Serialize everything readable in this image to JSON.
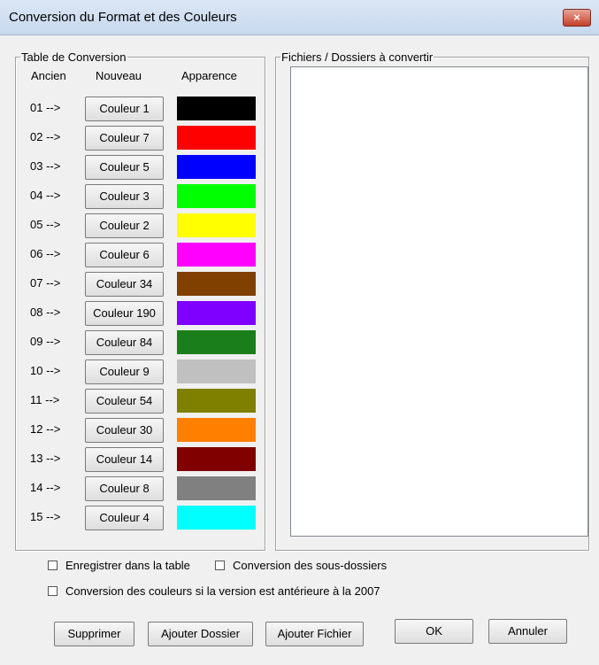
{
  "window": {
    "title": "Conversion du Format et des Couleurs",
    "close_label": "×"
  },
  "table_group": {
    "legend": "Table de Conversion",
    "header_old": "Ancien",
    "header_new": "Nouveau",
    "header_look": "Apparence",
    "rows": [
      {
        "old": "01 -->",
        "new": "Couleur 1",
        "color": "#000000"
      },
      {
        "old": "02 -->",
        "new": "Couleur 7",
        "color": "#ff0000"
      },
      {
        "old": "03 -->",
        "new": "Couleur 5",
        "color": "#0000ff"
      },
      {
        "old": "04 -->",
        "new": "Couleur 3",
        "color": "#00ff00"
      },
      {
        "old": "05 -->",
        "new": "Couleur 2",
        "color": "#ffff00"
      },
      {
        "old": "06 -->",
        "new": "Couleur 6",
        "color": "#ff00ff"
      },
      {
        "old": "07 -->",
        "new": "Couleur 34",
        "color": "#804000"
      },
      {
        "old": "08 -->",
        "new": "Couleur 190",
        "color": "#8000ff"
      },
      {
        "old": "09 -->",
        "new": "Couleur 84",
        "color": "#1a7f1a"
      },
      {
        "old": "10 -->",
        "new": "Couleur 9",
        "color": "#c0c0c0"
      },
      {
        "old": "11 -->",
        "new": "Couleur 54",
        "color": "#808000"
      },
      {
        "old": "12 -->",
        "new": "Couleur 30",
        "color": "#ff8000"
      },
      {
        "old": "13 -->",
        "new": "Couleur 14",
        "color": "#800000"
      },
      {
        "old": "14 -->",
        "new": "Couleur 8",
        "color": "#808080"
      },
      {
        "old": "15 -->",
        "new": "Couleur 4",
        "color": "#00ffff"
      }
    ]
  },
  "files_group": {
    "legend": "Fichiers / Dossiers à convertir"
  },
  "options": {
    "save_in_table": "Enregistrer dans la table",
    "convert_subfolders": "Conversion des sous-dossiers",
    "convert_colors_pre2007": "Conversion des couleurs si la version est antérieure à la 2007"
  },
  "buttons": {
    "delete": "Supprimer",
    "add_folder": "Ajouter Dossier",
    "add_file": "Ajouter Fichier",
    "ok": "OK",
    "cancel": "Annuler"
  }
}
